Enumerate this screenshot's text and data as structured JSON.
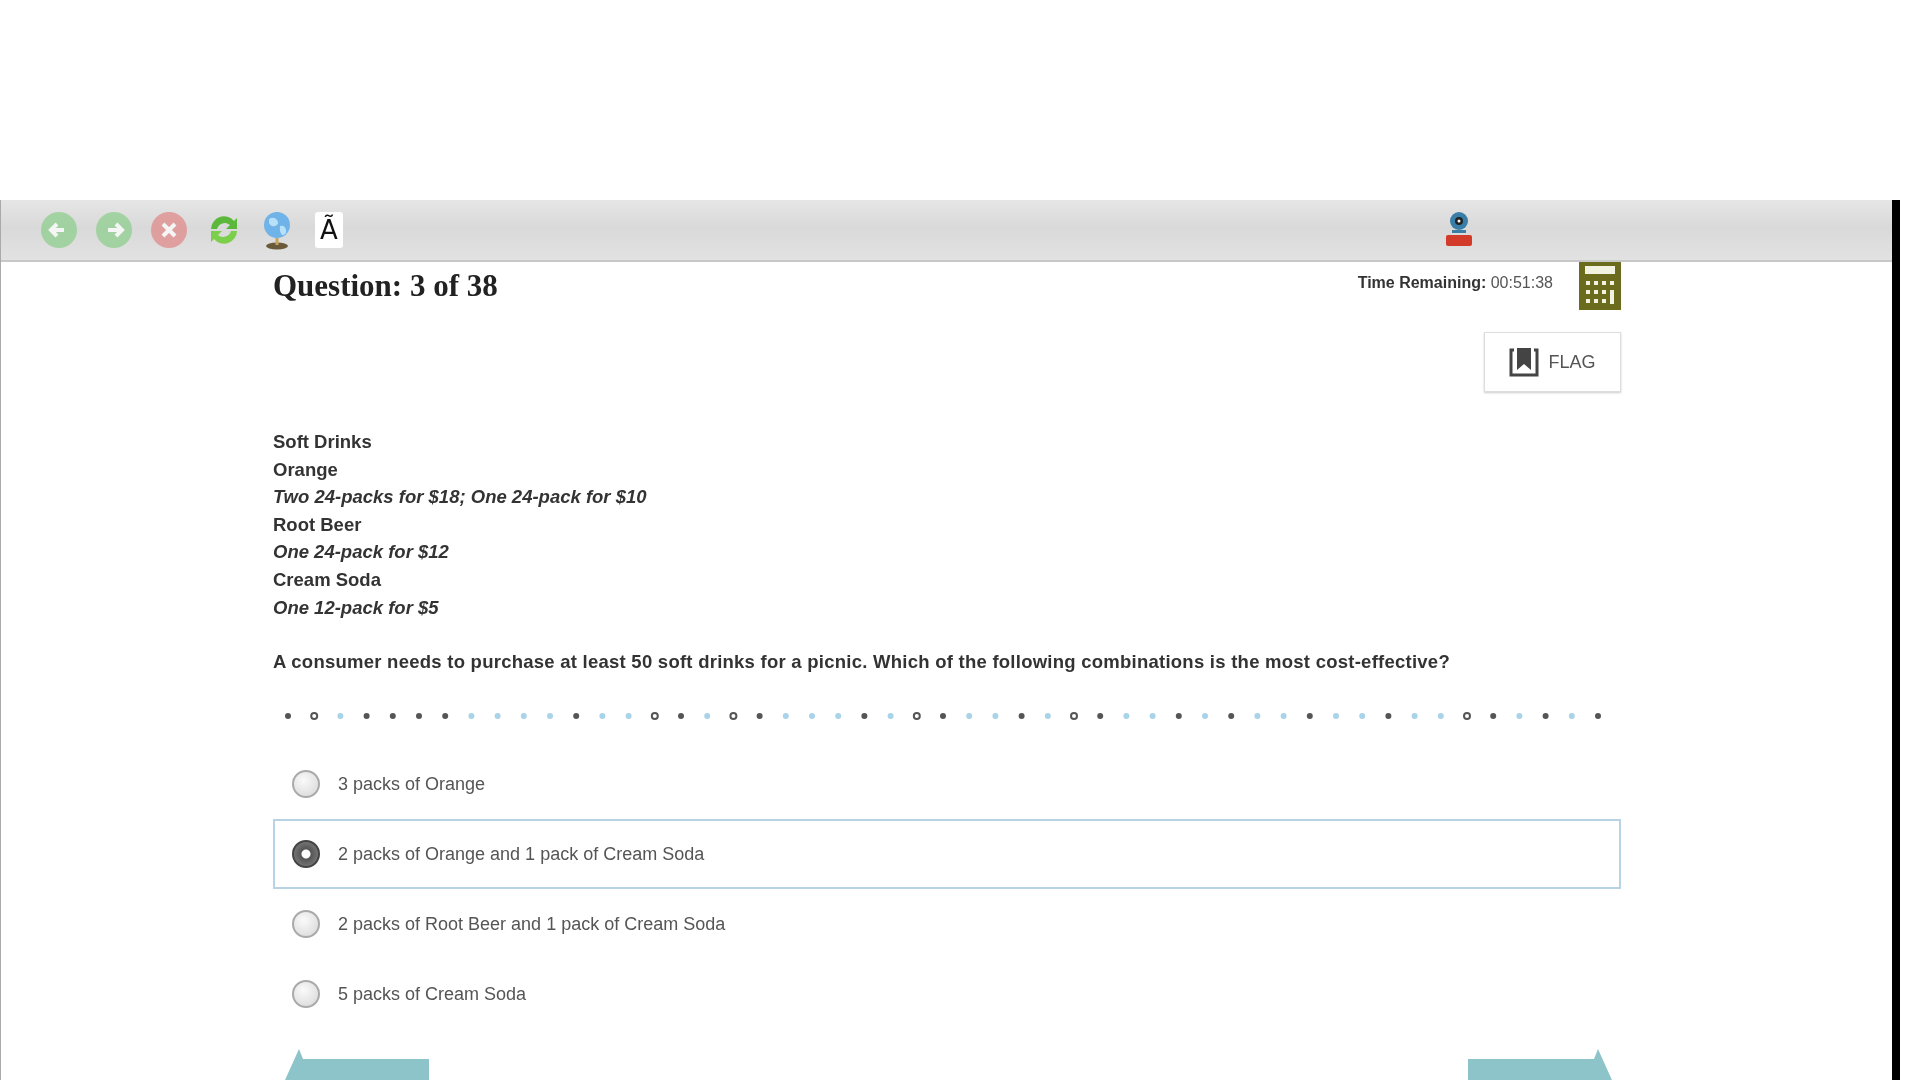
{
  "toolbar": {
    "font_button": "Ã"
  },
  "header": {
    "title": "Question: 3 of 38",
    "time_label": "Time Remaining:",
    "time_value": "00:51:38",
    "flag_label": "FLAG"
  },
  "passage": [
    {
      "kind": "heading",
      "text": "Soft Drinks"
    },
    {
      "kind": "heading",
      "text": "Orange"
    },
    {
      "kind": "detail",
      "text": "Two 24-packs for $18; One 24-pack for $10"
    },
    {
      "kind": "heading",
      "text": "Root Beer"
    },
    {
      "kind": "detail",
      "text": "One 24-pack for $12"
    },
    {
      "kind": "heading",
      "text": "Cream Soda"
    },
    {
      "kind": "detail",
      "text": "One 12-pack for $5"
    }
  ],
  "question": "A consumer needs to purchase at least 50 soft drinks for a picnic. Which of the following combinations is the most cost-effective?",
  "options": [
    {
      "label": "3 packs of Orange",
      "selected": false
    },
    {
      "label": "2 packs of Orange and 1 pack of Cream Soda",
      "selected": true
    },
    {
      "label": "2 packs of Root Beer and 1 pack of Cream Soda",
      "selected": false
    },
    {
      "label": "5 packs of Cream Soda",
      "selected": false
    }
  ]
}
